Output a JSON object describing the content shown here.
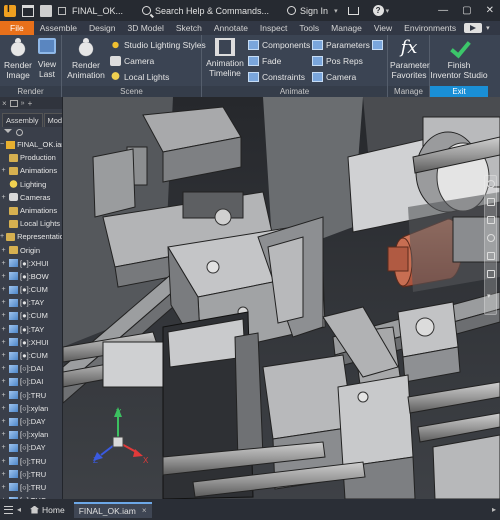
{
  "titlebar": {
    "document_title": "FINAL_OK...",
    "search_placeholder": "Search Help & Commands...",
    "signin_label": "Sign In",
    "help_symbol": "?",
    "minimize": "—",
    "maximize": "▢",
    "close": "✕"
  },
  "tabs": [
    "File",
    "Assemble",
    "Design",
    "3D Model",
    "Sketch",
    "Annotate",
    "Inspect",
    "Tools",
    "Manage",
    "View",
    "Environments"
  ],
  "ribbon": {
    "render": {
      "title": "Render",
      "render_image": "Render\nImage",
      "view_last": "View\nLast"
    },
    "scene": {
      "title": "Scene",
      "render_animation": "Render\nAnimation",
      "studio_lighting_styles": "Studio Lighting Styles",
      "camera": "Camera",
      "local_lights": "Local Lights"
    },
    "animate": {
      "title": "Animate",
      "animation_timeline": "Animation\nTimeline",
      "components": "Components",
      "fade": "Fade",
      "constraints": "Constraints",
      "parameters": "Parameters",
      "pos_reps": "Pos Reps",
      "camera": "Camera"
    },
    "manage": {
      "title": "Manage",
      "parameter_favorites": "Parameter\nFavorites"
    },
    "exit": {
      "title": "Exit",
      "finish": "Finish\nInventor Studio"
    }
  },
  "browser": {
    "close": "×",
    "tabs": [
      "Assembly",
      "Model"
    ],
    "tree": [
      {
        "label": "FINAL_OK.iam",
        "icon": "assembly-icon",
        "expand": "−"
      },
      {
        "label": "Production",
        "icon": "folder-icon",
        "expand": ""
      },
      {
        "label": "Animations",
        "icon": "folder-icon",
        "expand": "+"
      },
      {
        "label": "Lighting",
        "icon": "bulb-icon",
        "expand": ""
      },
      {
        "label": "Cameras",
        "icon": "camera-icon",
        "expand": "+"
      },
      {
        "label": "Animations",
        "icon": "folder-icon",
        "expand": ""
      },
      {
        "label": "Local Lights",
        "icon": "folder-icon",
        "expand": ""
      },
      {
        "label": "Representations",
        "icon": "folder-icon",
        "expand": "+"
      },
      {
        "label": "Origin",
        "icon": "folder-icon",
        "expand": "+"
      },
      {
        "label": "[●]:XHUI",
        "icon": "part-icon",
        "expand": "+"
      },
      {
        "label": "[●]:BOW",
        "icon": "part-icon",
        "expand": "+"
      },
      {
        "label": "[●]:CUM",
        "icon": "part-icon",
        "expand": "+"
      },
      {
        "label": "[●]:TAY",
        "icon": "part-icon",
        "expand": "+"
      },
      {
        "label": "[●]:CUM",
        "icon": "part-icon",
        "expand": "+"
      },
      {
        "label": "[●]:TAY",
        "icon": "part-icon",
        "expand": "+"
      },
      {
        "label": "[●]:XHUI",
        "icon": "part-icon",
        "expand": "+"
      },
      {
        "label": "[●]:CUM",
        "icon": "part-icon",
        "expand": "+"
      },
      {
        "label": "[○]:DAI",
        "icon": "part-icon",
        "expand": "+"
      },
      {
        "label": "[○]:DAI",
        "icon": "part-icon",
        "expand": "+"
      },
      {
        "label": "[○]:TRU",
        "icon": "part-icon",
        "expand": "+"
      },
      {
        "label": "[○]:xylan",
        "icon": "part-icon",
        "expand": "+"
      },
      {
        "label": "[○]:DAY",
        "icon": "part-icon",
        "expand": "+"
      },
      {
        "label": "[○]:xylan",
        "icon": "part-icon",
        "expand": "+"
      },
      {
        "label": "[○]:DAY",
        "icon": "part-icon",
        "expand": "+"
      },
      {
        "label": "[○]:TRU",
        "icon": "part-icon",
        "expand": "+"
      },
      {
        "label": "[○]:TRU",
        "icon": "part-icon",
        "expand": "+"
      },
      {
        "label": "[○]:TRU",
        "icon": "part-icon",
        "expand": "+"
      },
      {
        "label": "[○]:TUC",
        "icon": "part-icon",
        "expand": "+"
      },
      {
        "label": "[○]:TRU",
        "icon": "part-icon",
        "expand": "+"
      }
    ]
  },
  "viewport": {
    "axis_x": "X",
    "axis_y": "Y",
    "axis_z": "Z"
  },
  "bottombar": {
    "home_label": "Home",
    "doc_label": "FINAL_OK.iam",
    "close": "×",
    "scroll_left": "◂",
    "scroll_right": "▸"
  },
  "colors": {
    "file_tab": "#e8701a",
    "exit_accent": "#1a8fd6",
    "ribbon_bg": "#3b4453",
    "copper": "#c8664a"
  }
}
